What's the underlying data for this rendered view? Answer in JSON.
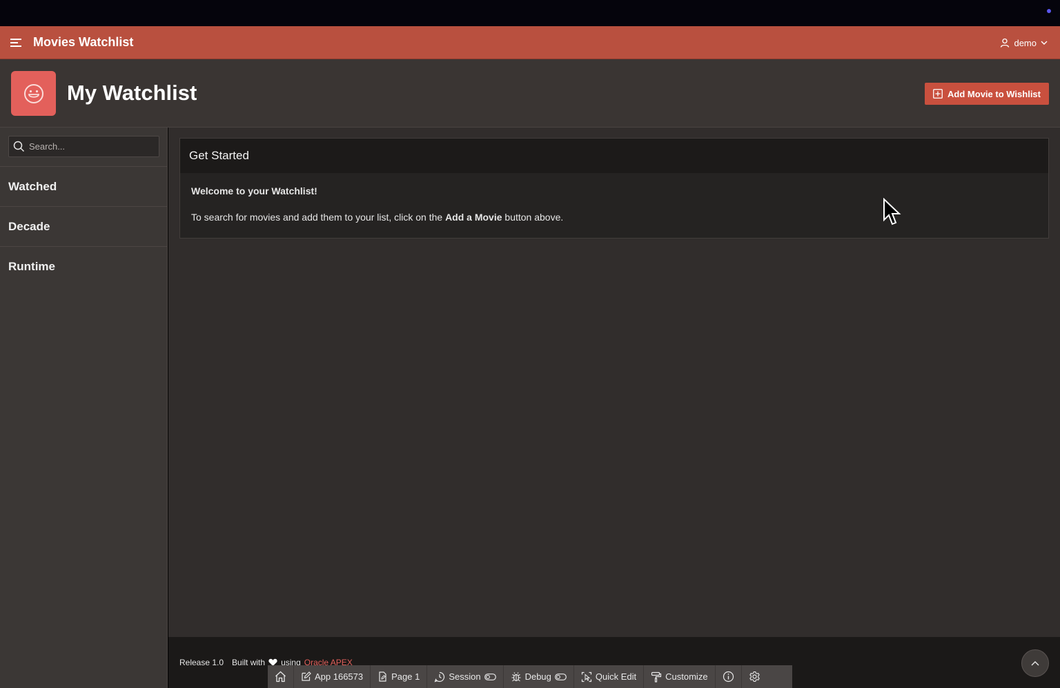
{
  "header": {
    "app_title": "Movies Watchlist",
    "user_name": "demo"
  },
  "hero": {
    "title": "My Watchlist",
    "add_button_label": "Add Movie to Wishlist"
  },
  "sidebar": {
    "search_placeholder": "Search...",
    "facets": [
      {
        "label": "Watched"
      },
      {
        "label": "Decade"
      },
      {
        "label": "Runtime"
      }
    ]
  },
  "card": {
    "title": "Get Started",
    "welcome": "Welcome to your Watchlist!",
    "text_before": "To search for movies and add them to your list, click on the ",
    "text_bold": "Add a Movie",
    "text_after": " button above."
  },
  "footer": {
    "release": "Release 1.0",
    "built_with": "Built with",
    "using": "using",
    "apex_link": "Oracle APEX"
  },
  "devbar": {
    "app": "App 166573",
    "page": "Page 1",
    "session": "Session",
    "debug": "Debug",
    "quick_edit": "Quick Edit",
    "customize": "Customize"
  },
  "colors": {
    "brand": "#b9503f",
    "accent": "#e3605b",
    "button": "#c9503e"
  }
}
